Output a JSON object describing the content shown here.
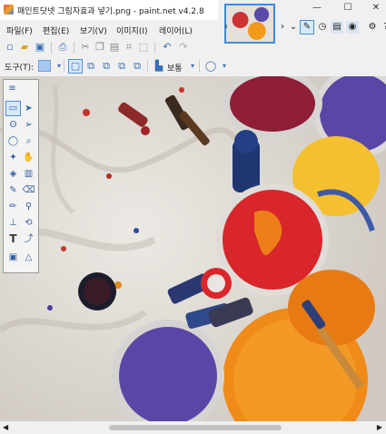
{
  "window": {
    "title": "패인트닷넷 그림자효과 넣기.png - paint.net v4.2.8",
    "minimize": "—",
    "maximize": "☐",
    "close": "✕"
  },
  "menu": {
    "items": [
      "파일(F)",
      "편집(E)",
      "보기(V)",
      "이미지(I)",
      "레이어(L)"
    ]
  },
  "toolbar2": {
    "tool_label": "도구(T):",
    "blend_mode": "보통",
    "antialias_icon": "antialias-icon"
  },
  "image_strip": {
    "thumbnail_name": "paint-cans-thumbnail"
  },
  "canvas": {
    "image_description_icon": "paint-cans-image"
  },
  "colors": {
    "accent": "#3c8be0",
    "red_paint": "#d8262a",
    "orange_paint": "#f08a18",
    "purple_paint": "#5a46a6",
    "yellow_paint": "#f5c030",
    "cloth": "#e8e4de"
  }
}
